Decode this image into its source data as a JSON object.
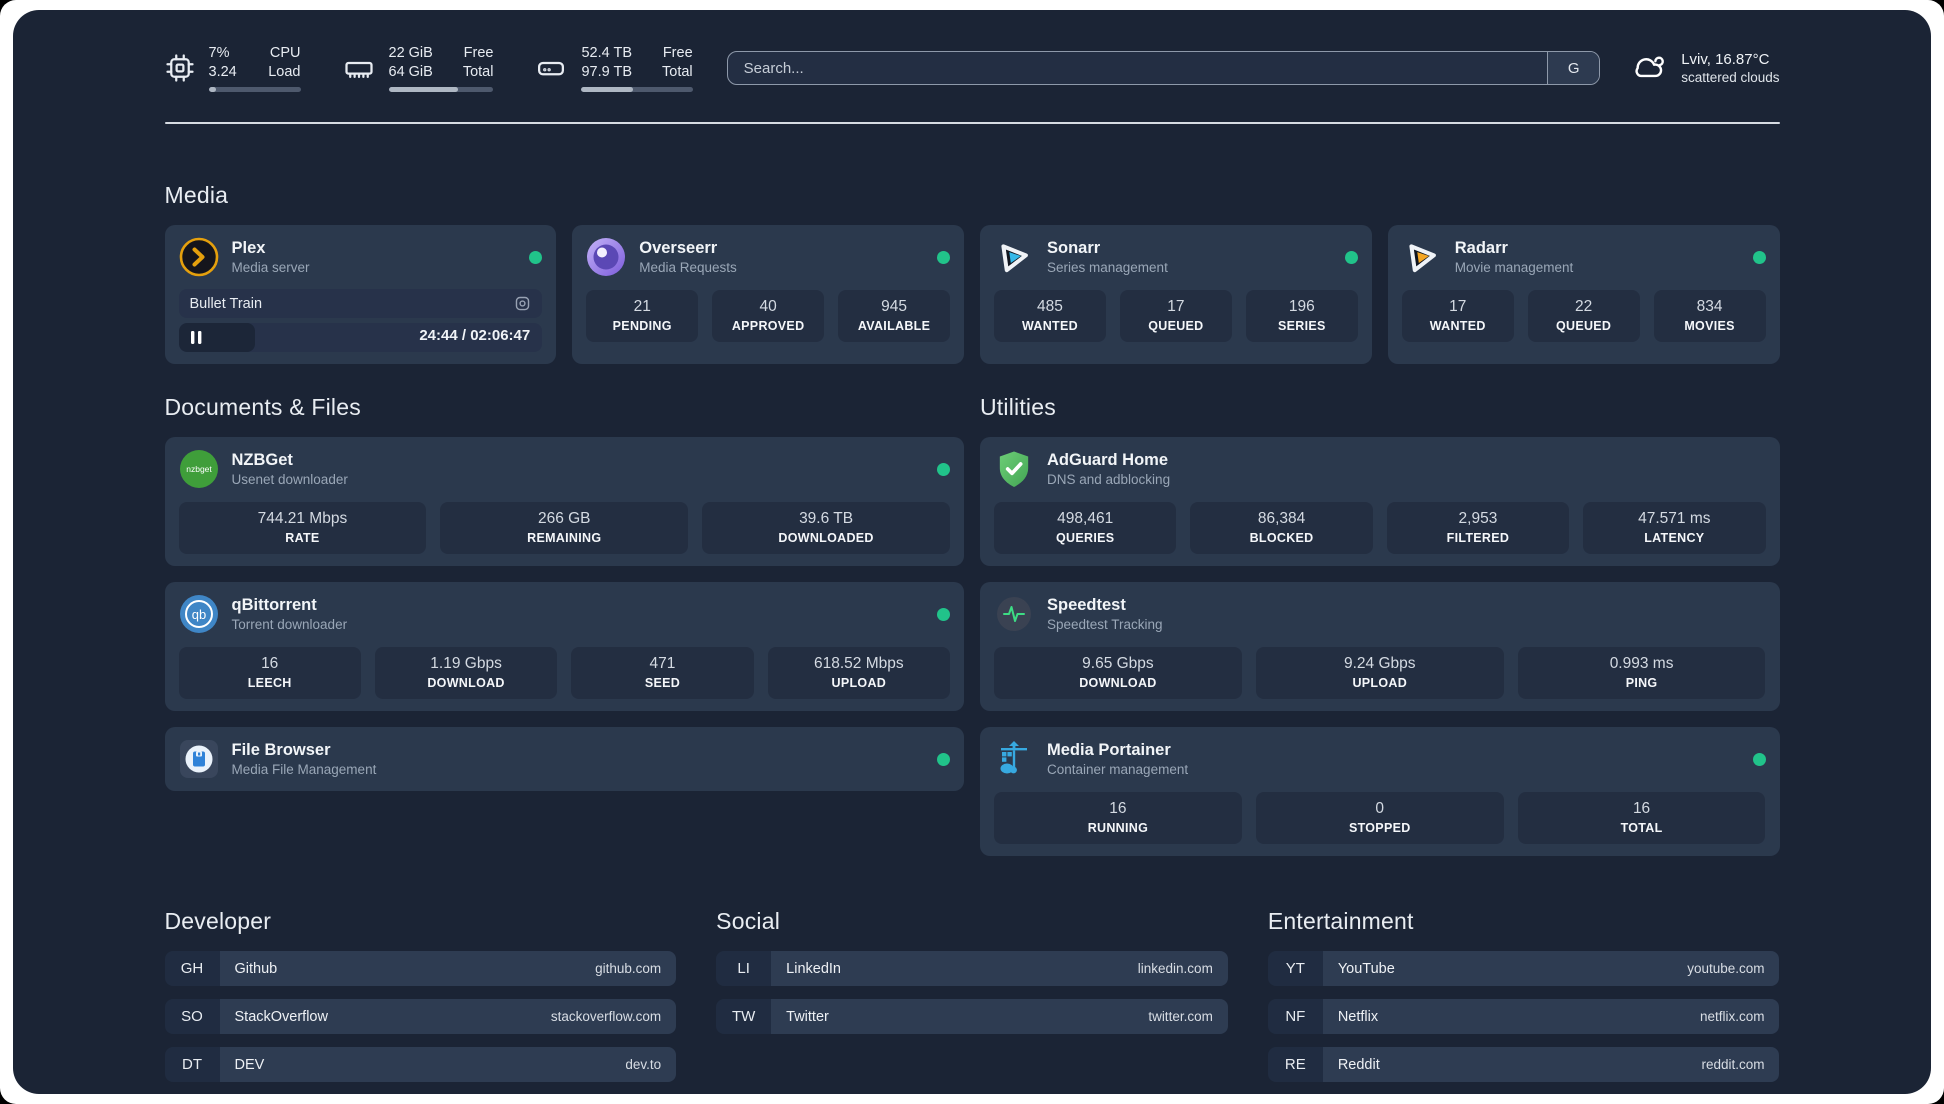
{
  "topbar": {
    "cpu": {
      "row1_value": "7%",
      "row1_label": "CPU",
      "row2_value": "3.24",
      "row2_label": "Load",
      "progress_pct": 8
    },
    "memory": {
      "row1_value": "22 GiB",
      "row1_label": "Free",
      "row2_value": "64 GiB",
      "row2_label": "Total",
      "progress_pct": 66
    },
    "disk": {
      "row1_value": "52.4 TB",
      "row1_label": "Free",
      "row2_value": "97.9 TB",
      "row2_label": "Total",
      "progress_pct": 46
    },
    "search": {
      "placeholder": "Search...",
      "provider_button": "G"
    },
    "weather": {
      "location": "Lviv, 16.87°C",
      "condition": "scattered clouds"
    }
  },
  "media": {
    "title": "Media",
    "plex": {
      "name": "Plex",
      "description": "Media server",
      "status": "online",
      "now_playing": {
        "title": "Bullet Train",
        "time_display": "24:44 / 02:06:47",
        "elapsed": "24:44",
        "duration": "02:06:47",
        "progress_pct": 21
      }
    },
    "overseerr": {
      "name": "Overseerr",
      "description": "Media Requests",
      "status": "online",
      "stats": [
        {
          "value": "21",
          "label": "PENDING"
        },
        {
          "value": "40",
          "label": "APPROVED"
        },
        {
          "value": "945",
          "label": "AVAILABLE"
        }
      ]
    },
    "sonarr": {
      "name": "Sonarr",
      "description": "Series management",
      "status": "online",
      "stats": [
        {
          "value": "485",
          "label": "WANTED"
        },
        {
          "value": "17",
          "label": "QUEUED"
        },
        {
          "value": "196",
          "label": "SERIES"
        }
      ]
    },
    "radarr": {
      "name": "Radarr",
      "description": "Movie management",
      "status": "online",
      "stats": [
        {
          "value": "17",
          "label": "WANTED"
        },
        {
          "value": "22",
          "label": "QUEUED"
        },
        {
          "value": "834",
          "label": "MOVIES"
        }
      ]
    }
  },
  "documents": {
    "title": "Documents & Files",
    "nzbget": {
      "name": "NZBGet",
      "description": "Usenet downloader",
      "status": "online",
      "stats": [
        {
          "value": "744.21 Mbps",
          "label": "RATE"
        },
        {
          "value": "266 GB",
          "label": "REMAINING"
        },
        {
          "value": "39.6 TB",
          "label": "DOWNLOADED"
        }
      ]
    },
    "qbittorrent": {
      "name": "qBittorrent",
      "description": "Torrent downloader",
      "status": "online",
      "stats": [
        {
          "value": "16",
          "label": "LEECH"
        },
        {
          "value": "1.19 Gbps",
          "label": "DOWNLOAD"
        },
        {
          "value": "471",
          "label": "SEED"
        },
        {
          "value": "618.52 Mbps",
          "label": "UPLOAD"
        }
      ]
    },
    "filebrowser": {
      "name": "File Browser",
      "description": "Media File Management",
      "status": "online"
    }
  },
  "utilities": {
    "title": "Utilities",
    "adguard": {
      "name": "AdGuard Home",
      "description": "DNS and adblocking",
      "status": "online",
      "stats": [
        {
          "value": "498,461",
          "label": "QUERIES"
        },
        {
          "value": "86,384",
          "label": "BLOCKED"
        },
        {
          "value": "2,953",
          "label": "FILTERED"
        },
        {
          "value": "47.571 ms",
          "label": "LATENCY"
        }
      ]
    },
    "speedtest": {
      "name": "Speedtest",
      "description": "Speedtest Tracking",
      "stats": [
        {
          "value": "9.65 Gbps",
          "label": "DOWNLOAD"
        },
        {
          "value": "9.24 Gbps",
          "label": "UPLOAD"
        },
        {
          "value": "0.993 ms",
          "label": "PING"
        }
      ]
    },
    "portainer": {
      "name": "Media Portainer",
      "description": "Container management",
      "status": "online",
      "stats": [
        {
          "value": "16",
          "label": "RUNNING"
        },
        {
          "value": "0",
          "label": "STOPPED"
        },
        {
          "value": "16",
          "label": "TOTAL"
        }
      ]
    }
  },
  "bookmarks": {
    "developer": {
      "title": "Developer",
      "items": [
        {
          "abbr": "GH",
          "name": "Github",
          "url": "github.com"
        },
        {
          "abbr": "SO",
          "name": "StackOverflow",
          "url": "stackoverflow.com"
        },
        {
          "abbr": "DT",
          "name": "DEV",
          "url": "dev.to"
        }
      ]
    },
    "social": {
      "title": "Social",
      "items": [
        {
          "abbr": "LI",
          "name": "LinkedIn",
          "url": "linkedin.com"
        },
        {
          "abbr": "TW",
          "name": "Twitter",
          "url": "twitter.com"
        }
      ]
    },
    "entertainment": {
      "title": "Entertainment",
      "items": [
        {
          "abbr": "YT",
          "name": "YouTube",
          "url": "youtube.com"
        },
        {
          "abbr": "NF",
          "name": "Netflix",
          "url": "netflix.com"
        },
        {
          "abbr": "RE",
          "name": "Reddit",
          "url": "reddit.com"
        }
      ]
    }
  },
  "colors": {
    "page_background": "#1b2435",
    "card_background": "#2b394d",
    "stat_box_background": "#232e41",
    "status_online": "#21c38a",
    "sonarr_accent": "#35b8e8",
    "radarr_accent": "#f5a623",
    "plex_accent": "#e5a00d",
    "adguard_accent": "#57c161",
    "portainer_accent": "#37a9e0",
    "nzbget_accent": "#3f9e3a",
    "qbittorrent_accent": "#3f86c6",
    "overseerr_accent": "#8b6ce0"
  }
}
